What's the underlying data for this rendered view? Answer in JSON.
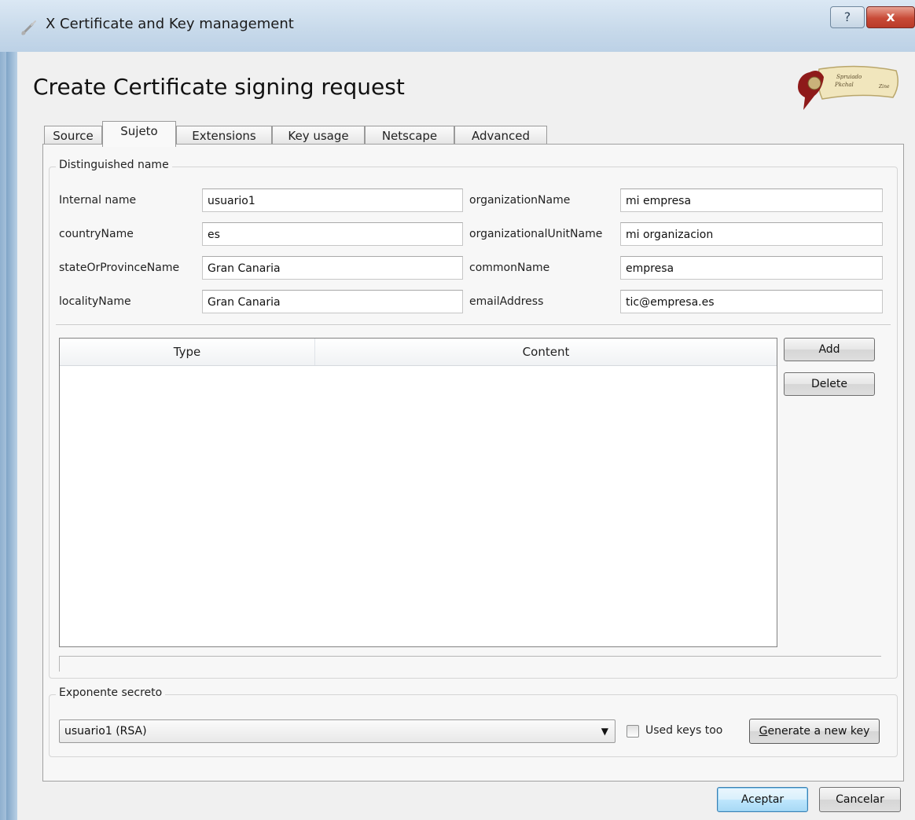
{
  "window": {
    "title": "X Certificate and Key management",
    "help_label": "?",
    "close_label": "x"
  },
  "dialog": {
    "heading": "Create Certificate signing request",
    "logo_text": [
      "Spruiado",
      "Pkchal",
      "Zine"
    ]
  },
  "tabs": [
    {
      "label": "Source",
      "active": false
    },
    {
      "label": "Sujeto",
      "active": true
    },
    {
      "label": "Extensions",
      "active": false
    },
    {
      "label": "Key usage",
      "active": false
    },
    {
      "label": "Netscape",
      "active": false
    },
    {
      "label": "Advanced",
      "active": false
    }
  ],
  "distinguished_name": {
    "title": "Distinguished name",
    "left": [
      {
        "label": "Internal name",
        "value": "usuario1"
      },
      {
        "label": "countryName",
        "value": "es"
      },
      {
        "label": "stateOrProvinceName",
        "value": "Gran Canaria"
      },
      {
        "label": "localityName",
        "value": "Gran Canaria"
      }
    ],
    "right": [
      {
        "label": "organizationName",
        "value": "mi empresa"
      },
      {
        "label": "organizationalUnitName",
        "value": "mi organizacion"
      },
      {
        "label": "commonName",
        "value": "empresa"
      },
      {
        "label": "emailAddress",
        "value": "tic@empresa.es"
      }
    ],
    "table": {
      "columns": [
        "Type",
        "Content"
      ],
      "rows": []
    },
    "add_label": "Add",
    "delete_label": "Delete"
  },
  "private_key": {
    "title": "Exponente secreto",
    "selected": "usuario1 (RSA)",
    "used_keys_label": "Used keys too",
    "used_keys_checked": false,
    "generate_prefix": "G",
    "generate_rest": "enerate a new key"
  },
  "footer": {
    "ok_label": "Aceptar",
    "cancel_label": "Cancelar"
  },
  "colors": {
    "titlebar": "#c7d9ea",
    "close_button": "#c84a37",
    "default_button_border": "#3c7fb1",
    "dialog_bg": "#f0f0f0"
  }
}
